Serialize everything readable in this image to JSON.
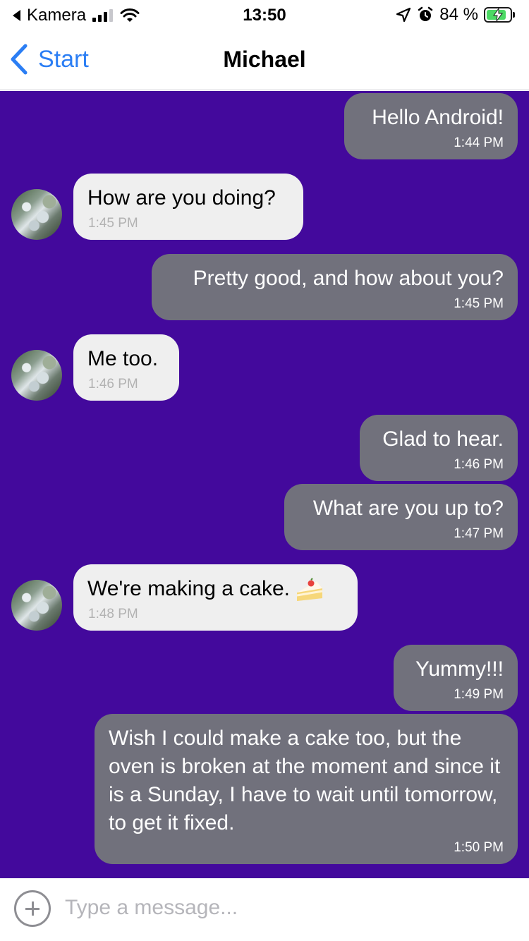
{
  "status_bar": {
    "back_app": "Kamera",
    "time": "13:50",
    "battery": "84 %",
    "battery_level": 0.84
  },
  "nav": {
    "back_label": "Start",
    "title": "Michael"
  },
  "colors": {
    "chat_background": "#43099c",
    "outgoing_bubble": "#71717c",
    "incoming_bubble": "#efefef",
    "accent": "#2b7ef4"
  },
  "messages": [
    {
      "dir": "out",
      "text": "Hello Android!",
      "time": "1:44 PM"
    },
    {
      "dir": "in",
      "text": "How are you doing?",
      "time": "1:45 PM"
    },
    {
      "dir": "out",
      "text": "Pretty good, and how about you?",
      "time": "1:45 PM"
    },
    {
      "dir": "in",
      "text": "Me too.",
      "time": "1:46 PM"
    },
    {
      "dir": "out",
      "text": "Glad to hear.",
      "time": "1:46 PM"
    },
    {
      "dir": "out",
      "text": "What are you up to?",
      "time": "1:47 PM"
    },
    {
      "dir": "in",
      "text": "We're making a cake.",
      "emoji": "shortcake-icon",
      "time": "1:48 PM"
    },
    {
      "dir": "out",
      "text": "Yummy!!!",
      "time": "1:49 PM"
    },
    {
      "dir": "out",
      "text": "Wish I could make a cake too, but the oven is broken at the moment and since it is a Sunday, I have to wait until tomorrow, to get it fixed.",
      "time": "1:50 PM"
    }
  ],
  "composer": {
    "placeholder": "Type a message..."
  }
}
